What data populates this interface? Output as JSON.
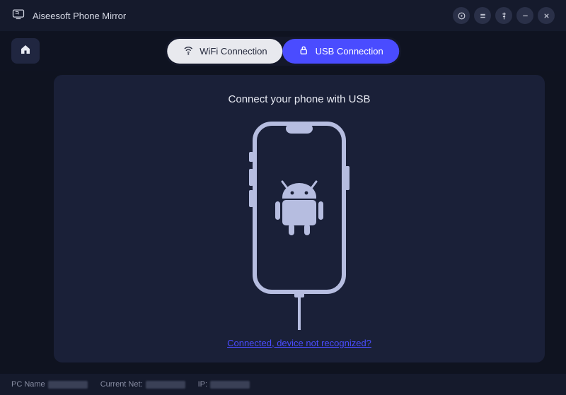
{
  "app": {
    "title": "Aiseesoft Phone Mirror"
  },
  "tabs": {
    "wifi": "WiFi Connection",
    "usb": "USB Connection",
    "active": "usb"
  },
  "panel": {
    "title": "Connect your phone with USB",
    "help_link": "Connected, device not recognized?"
  },
  "footer": {
    "pc_name_label": "PC Name",
    "current_net_label": "Current Net:",
    "ip_label": "IP:"
  },
  "colors": {
    "accent": "#4a4cff",
    "bg": "#0f1320",
    "panel": "#1a2038",
    "phone_fill": "#b6bde0"
  }
}
